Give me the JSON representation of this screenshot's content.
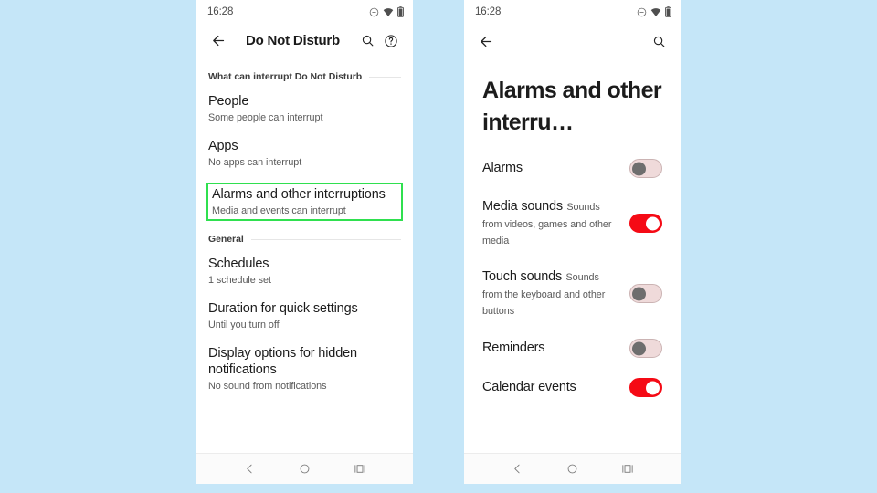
{
  "theme": {
    "page_background": "#c5e6f8",
    "accent_on": "#f50a15",
    "switch_off_track": "#efdada",
    "switch_off_knob": "#6e6e6e",
    "highlight_border": "#2fe04f"
  },
  "left_phone": {
    "status_bar": {
      "time": "16:28",
      "icons": [
        "do-not-disturb-icon",
        "wifi-icon",
        "battery-icon"
      ]
    },
    "app_bar": {
      "back_label": "back-arrow-icon",
      "title": "Do Not Disturb",
      "search_label": "search-icon",
      "help_label": "help-circle-icon"
    },
    "sections": [
      {
        "header": "What can interrupt Do Not Disturb",
        "items": [
          {
            "title": "People",
            "subtitle": "Some people can interrupt",
            "highlighted": false
          },
          {
            "title": "Apps",
            "subtitle": "No apps can interrupt",
            "highlighted": false
          },
          {
            "title": "Alarms and other interruptions",
            "subtitle": "Media and events can interrupt",
            "highlighted": true
          }
        ]
      },
      {
        "header": "General",
        "items": [
          {
            "title": "Schedules",
            "subtitle": "1 schedule set",
            "highlighted": false
          },
          {
            "title": "Duration for quick settings",
            "subtitle": "Until you turn off",
            "highlighted": false
          },
          {
            "title": "Display options for hidden notifications",
            "subtitle": "No sound from notifications",
            "highlighted": false
          }
        ]
      }
    ],
    "nav_bar": [
      "back-nav-icon",
      "home-nav-icon",
      "recents-nav-icon"
    ]
  },
  "right_phone": {
    "status_bar": {
      "time": "16:28",
      "icons": [
        "do-not-disturb-icon",
        "wifi-icon",
        "battery-icon"
      ]
    },
    "app_bar": {
      "back_label": "back-arrow-icon",
      "search_label": "search-icon"
    },
    "page_title": "Alarms and other interru…",
    "toggles": [
      {
        "title": "Alarms",
        "subtitle": "",
        "state": "off"
      },
      {
        "title": "Media sounds",
        "subtitle": "Sounds from videos, games and other media",
        "state": "on"
      },
      {
        "title": "Touch sounds",
        "subtitle": "Sounds from the keyboard and other buttons",
        "state": "off"
      },
      {
        "title": "Reminders",
        "subtitle": "",
        "state": "off"
      },
      {
        "title": "Calendar events",
        "subtitle": "",
        "state": "on"
      }
    ],
    "nav_bar": [
      "back-nav-icon",
      "home-nav-icon",
      "recents-nav-icon"
    ]
  }
}
